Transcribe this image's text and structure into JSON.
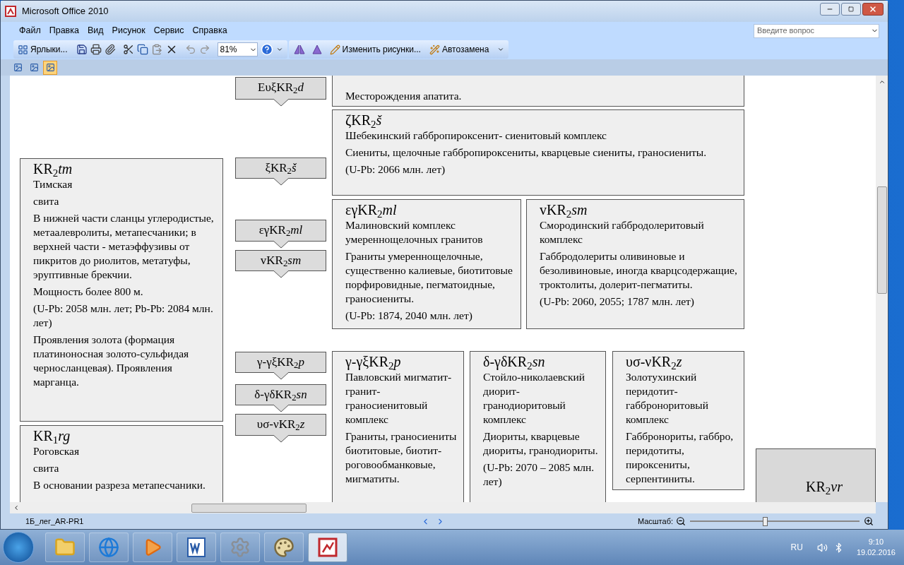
{
  "window": {
    "title": "Microsoft Office 2010"
  },
  "menu": [
    "Файл",
    "Правка",
    "Вид",
    "Рисунок",
    "Сервис",
    "Справка"
  ],
  "help_search": {
    "placeholder": "Введите вопрос"
  },
  "toolbar": {
    "shortcuts_button": "Ярлыки...",
    "zoom_value": "81%",
    "change_pictures_button": "Изменить рисунки...",
    "autoreplace_button": "Автозамена"
  },
  "view_buttons": [
    {
      "selected": false
    },
    {
      "selected": false
    },
    {
      "selected": true
    }
  ],
  "diagram": {
    "labels": [
      {
        "text": "EυξKR$_{2}$*d*"
      },
      {
        "text": "ξKR$_{2}$*š*"
      },
      {
        "text": "εγKR$_{2}$*ml*"
      },
      {
        "text": "vKR$_{2}$*sm*"
      },
      {
        "text": "γ-γξKR$_{2}$*p*"
      },
      {
        "text": "δ-γδKR$_{2}$*sn*"
      },
      {
        "text": "υσ-νKR$_{2}$*z*"
      }
    ],
    "boxes": [
      {
        "symbol": "KR$_{2}$*tm*",
        "paragraphs": [
          "Тимская",
          "свита",
          "В нижней части сланцы углеродистые, метаалевролиты, метапесчаники; в верхней части - метаэффузивы от пикритов до риолитов, метатуфы, эруптивные брекчии.",
          "Мощность более 800 м.",
          "(U-Pb: 2058 млн. лет; Pb-Pb: 2084 млн. лет)",
          "Проявления золота (формация платиноносная золото-сульфидая черносланцевая). Проявления марганца."
        ]
      },
      {
        "symbol": "KR$_{1}$*rg*",
        "paragraphs": [
          "Роговская",
          "свита",
          "В основании разреза метапесчаники."
        ]
      },
      {
        "paragraphs": [
          "Месторождения апатита."
        ]
      },
      {
        "symbol": "ζKR$_{2}$*š*",
        "paragraphs": [
          "Шебекинский габбропироксенит- сиенитовый комплекс",
          "Сиениты, щелочные габбропироксениты, кварцевые сиениты, граносиениты.",
          "(U-Pb: 2066 млн. лет)"
        ]
      },
      {
        "symbol": "εγKR$_{2}$*ml*",
        "paragraphs": [
          "Малиновский комплекс умереннощелочных гранитов",
          "Граниты умереннощелочные, существенно калиевые, биотитовые порфировидные, пегматоидные, граносиениты.",
          "(U-Pb: 1874, 2040 млн. лет)"
        ]
      },
      {
        "symbol": "vKR$_{2}$*sm*",
        "paragraphs": [
          "Смородинский габбродолеритовый комплекс",
          "Габбродолериты оливиновые и безоливиновые, иногда кварцсодержащие, троктолиты, долерит-пегматиты.",
          "(U-Pb: 2060, 2055; 1787 млн. лет)"
        ]
      },
      {
        "symbol": "γ-γξKR$_{2}$*p*",
        "paragraphs": [
          "Павловский мигматит- гранит-граносиенитовый комплекс",
          "Граниты, граносиениты биотитовые, биотит-роговообманковые, мигматиты."
        ]
      },
      {
        "symbol": "δ-γδKR$_{2}$*sn*",
        "paragraphs": [
          "Стойло-николаевский диорит-гранодиоритовый комплекс",
          "Диориты, кварцевые диориты, гранодиориты.",
          "(U-Pb:  2070 – 2085 млн. лет)"
        ]
      },
      {
        "symbol": "υσ-νKR$_{2}$*z*",
        "paragraphs": [
          "Золотухинский перидотит-габброноритовый комплекс",
          "Габбронориты, габбро, перидотиты, пироксениты, серпентиниты."
        ]
      },
      {
        "symbol": "KR$_{2}$*vr*"
      }
    ]
  },
  "status_bar": {
    "sheet": "1Б_лег_AR-PR1",
    "zoom_label": "Масштаб:",
    "zoom_slider": {
      "level": 0.44
    }
  },
  "taskbar": {
    "apps": [
      {
        "kind": "folder",
        "selected": false
      },
      {
        "kind": "browser",
        "selected": false
      },
      {
        "kind": "media",
        "selected": false
      },
      {
        "kind": "word",
        "selected": false
      },
      {
        "kind": "settings",
        "selected": false
      },
      {
        "kind": "paint",
        "selected": false
      },
      {
        "kind": "office",
        "selected": true
      }
    ],
    "language": "RU",
    "time": "9:10",
    "date": "19.02.2016"
  }
}
